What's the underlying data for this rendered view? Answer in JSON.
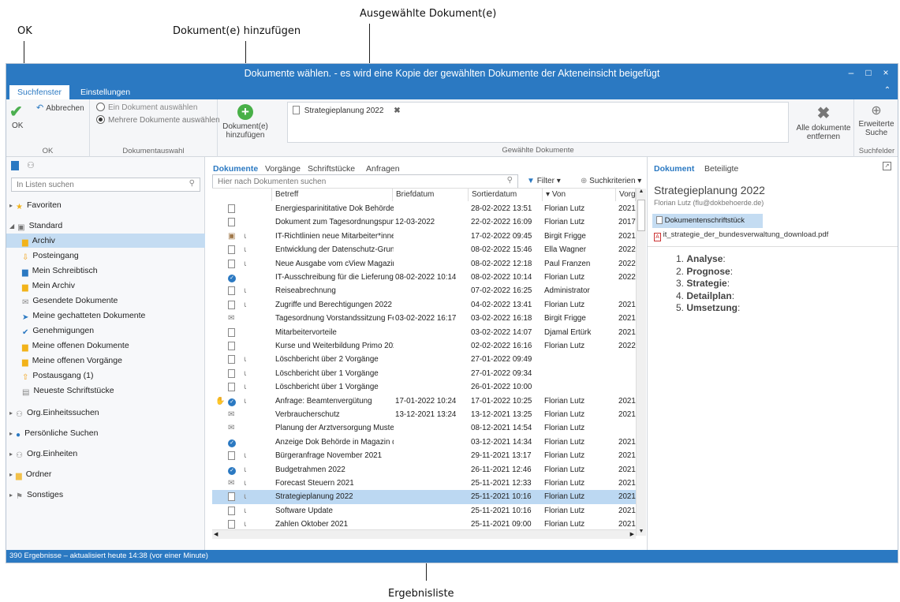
{
  "annotations": {
    "ok": "OK",
    "add": "Dokument(e) hinzufügen",
    "selected": "Ausgewählte Dokument(e)",
    "results": "Ergebnisliste"
  },
  "window": {
    "title": "Dokumente wählen. - es wird eine Kopie der gewählten Dokumente der Akteneinsicht beigefügt",
    "minimize": "–",
    "maximize": "□",
    "close": "×"
  },
  "tabs": [
    "Suchfenster",
    "Einstellungen"
  ],
  "ribbon": {
    "ok_label": "OK",
    "cancel_label": "Abbrechen",
    "group_ok": "OK",
    "radio_single": "Ein Dokument auswählen",
    "radio_multi": "Mehrere Dokumente auswählen",
    "group_auswahl": "Dokumentauswahl",
    "add_label_1": "Dokument(e)",
    "add_label_2": "hinzufügen",
    "selected_doc": "Strategieplanung 2022",
    "group_selected": "Gewählte Dokumente",
    "remove_1": "Alle dokumente",
    "remove_2": "entfernen",
    "search_1": "Erweiterte",
    "search_2": "Suche",
    "group_suchfelder": "Suchfelder"
  },
  "nav": {
    "search_placeholder": "In Listen suchen",
    "items": [
      "Favoriten",
      "Standard",
      "Archiv",
      "Posteingang",
      "Mein Schreibtisch",
      "Mein Archiv",
      "Gesendete Dokumente",
      "Meine gechatteten Dokumente",
      "Genehmigungen",
      "Meine offenen Dokumente",
      "Meine offenen Vorgänge",
      "Postausgang (1)",
      "Neueste Schriftstücke",
      "Org.Einheitssuchen",
      "Persönliche Suchen",
      "Org.Einheiten",
      "Ordner",
      "Sonstiges"
    ]
  },
  "center": {
    "tabs": [
      "Dokumente",
      "Vorgänge",
      "Schriftstücke",
      "Anfragen"
    ],
    "search_placeholder": "Hier nach Dokumenten suchen",
    "filter": "Filter",
    "criteria": "Suchkriterien",
    "columns": [
      "Betreff",
      "Briefdatum",
      "Sortierdatum",
      "Von",
      "Vorg"
    ],
    "rows": [
      [
        "Energiesparinititative Dok Behörde",
        "",
        "28-02-2022 13:51",
        "Florian Lutz",
        "2021"
      ],
      [
        "Dokument zum Tagesordnungspun...",
        "12-03-2022",
        "22-02-2022 16:09",
        "Florian Lutz",
        "2017"
      ],
      [
        "IT-Richtlinien neue Mitarbeiter*innen",
        "",
        "17-02-2022 09:45",
        "Birgit Frigge",
        "2021"
      ],
      [
        "Entwicklung der Datenschutz-Grun...",
        "",
        "08-02-2022 15:46",
        "Ella Wagner",
        "2022"
      ],
      [
        "Neue Ausgabe vom cView Magazin...",
        "",
        "08-02-2022 12:18",
        "Paul Franzen",
        "2022"
      ],
      [
        "IT-Ausschreibung für die Lieferung...",
        "08-02-2022 10:14",
        "08-02-2022 10:14",
        "Florian Lutz",
        "2022"
      ],
      [
        "Reiseabrechnung",
        "",
        "07-02-2022 16:25",
        "Administrator",
        ""
      ],
      [
        "Zugriffe und Berechtigungen 2022",
        "",
        "04-02-2022 13:41",
        "Florian Lutz",
        "2021"
      ],
      [
        "Tagesordnung Vorstandssitzung Fe...",
        "03-02-2022 16:17",
        "03-02-2022 16:18",
        "Birgit Frigge",
        "2021"
      ],
      [
        "Mitarbeitervorteile",
        "",
        "03-02-2022 14:07",
        "Djamal Ertürk",
        "2021"
      ],
      [
        "Kurse und Weiterbildung Primo 2022",
        "",
        "02-02-2022 16:16",
        "Florian Lutz",
        "2022"
      ],
      [
        "Löschbericht über 2 Vorgänge",
        "",
        "27-01-2022 09:49",
        "",
        ""
      ],
      [
        "Löschbericht über 1 Vorgänge",
        "",
        "27-01-2022 09:34",
        "",
        ""
      ],
      [
        "Löschbericht über 1 Vorgänge",
        "",
        "26-01-2022 10:00",
        "",
        ""
      ],
      [
        "Anfrage: Beamtenvergütung",
        "17-01-2022 10:24",
        "17-01-2022 10:25",
        "Florian Lutz",
        "2021"
      ],
      [
        "Verbraucherschutz",
        "13-12-2021 13:24",
        "13-12-2021 13:25",
        "Florian Lutz",
        "2021"
      ],
      [
        "Planung der Arztversorgung Muste...",
        "",
        "08-12-2021 14:54",
        "Florian Lutz",
        ""
      ],
      [
        "Anzeige Dok Behörde in Magazin d...",
        "",
        "03-12-2021 14:34",
        "Florian Lutz",
        "2021"
      ],
      [
        "Bürgeranfrage November 2021",
        "",
        "29-11-2021 13:17",
        "Florian Lutz",
        "2021"
      ],
      [
        "Budgetrahmen 2022",
        "",
        "26-11-2021 12:46",
        "Florian Lutz",
        "2021"
      ],
      [
        "Forecast Steuern 2021",
        "",
        "25-11-2021 12:33",
        "Florian Lutz",
        "2021"
      ],
      [
        "Strategieplanung 2022",
        "",
        "25-11-2021 10:16",
        "Florian Lutz",
        "2021"
      ],
      [
        "Software Update",
        "",
        "25-11-2021 10:16",
        "Florian Lutz",
        "2021"
      ],
      [
        "Zahlen Oktober 2021",
        "",
        "25-11-2021 09:00",
        "Florian Lutz",
        "2021"
      ]
    ]
  },
  "right": {
    "tabs": [
      "Dokument",
      "Beteiligte"
    ],
    "title": "Strategieplanung 2022",
    "author": "Florian Lutz (flu@dokbehoerde.de)",
    "files": [
      "Dokumentenschriftstück",
      "it_strategie_der_bundesverwaltung_download.pdf"
    ],
    "list": [
      "1. ",
      "Analyse",
      ":",
      "2. ",
      "Prognose",
      ":",
      "3. ",
      "Strategie",
      ":",
      "4. ",
      "Detailplan",
      ":",
      "5. ",
      "Umsetzung",
      ":"
    ]
  },
  "status": "390 Ergebnisse – aktualisiert heute 14:38 (vor einer Minute)"
}
